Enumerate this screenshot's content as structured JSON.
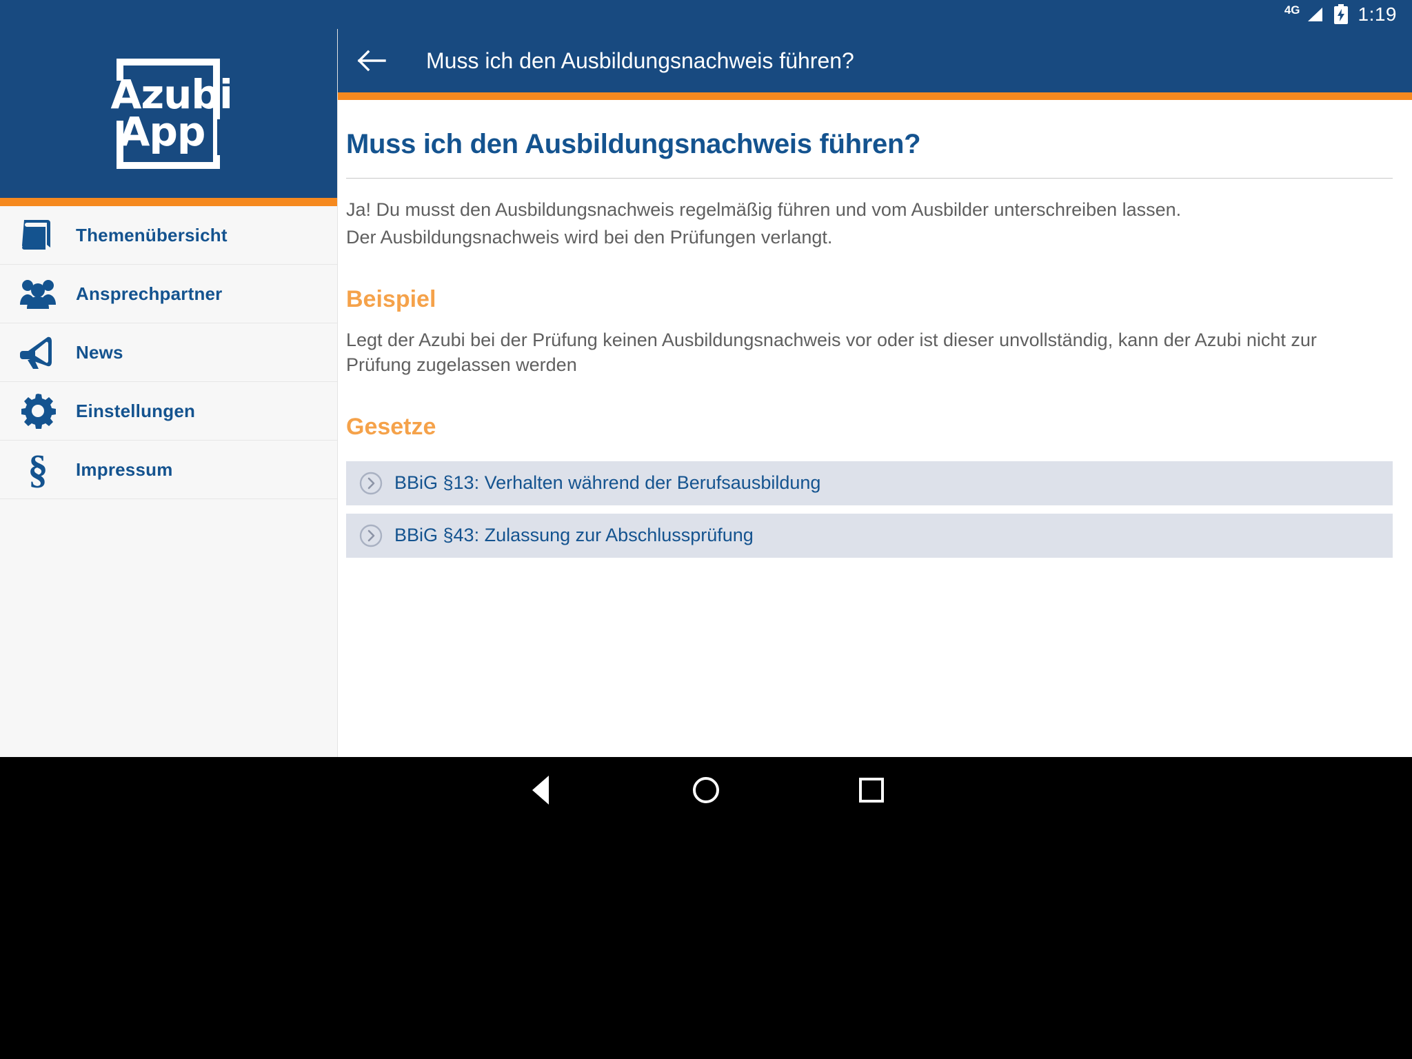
{
  "status_bar": {
    "network": "4G",
    "time": "1:19",
    "icons": [
      "signal-icon",
      "battery-charging-icon"
    ]
  },
  "drawer": {
    "logo": {
      "line1": "Azubi",
      "line2": "App",
      "alt": "Azubi App"
    },
    "items": [
      {
        "label": "Themenübersicht",
        "icon": "book-icon"
      },
      {
        "label": "Ansprechpartner",
        "icon": "people-group-icon"
      },
      {
        "label": "News",
        "icon": "megaphone-icon"
      },
      {
        "label": "Einstellungen",
        "icon": "gear-icon"
      },
      {
        "label": "Impressum",
        "icon": "section-sign-icon"
      }
    ]
  },
  "appbar": {
    "back_icon": "arrow-left-icon",
    "title": "Muss ich den Ausbildungsnachweis führen?"
  },
  "content": {
    "page_title": "Muss ich den Ausbildungsnachweis führen?",
    "paragraphs": [
      "Ja! Du musst den Ausbildungsnachweis regelmäßig führen und vom Ausbilder unterschreiben lassen.",
      "Der Ausbildungsnachweis wird bei den Prüfungen verlangt."
    ],
    "example_heading": "Beispiel",
    "example_text": "Legt der Azubi bei der Prüfung keinen Ausbildungsnachweis vor oder ist dieser unvollständig, kann der Azubi nicht zur Prüfung zugelassen werden",
    "laws_heading": "Gesetze",
    "laws": [
      "BBiG §13: Verhalten während der Berufsausbildung",
      "BBiG §43: Zulassung zur Abschlussprüfung"
    ]
  },
  "nav_bar": {
    "buttons": [
      "back-triangle-icon",
      "home-circle-icon",
      "recents-square-icon"
    ]
  },
  "colors": {
    "brand_blue": "#184a80",
    "link_blue": "#14538f",
    "accent_orange": "#f5891f",
    "heading_orange": "#f5a24a",
    "law_box": "#dde1ea",
    "body_text": "#5f5f5f"
  }
}
